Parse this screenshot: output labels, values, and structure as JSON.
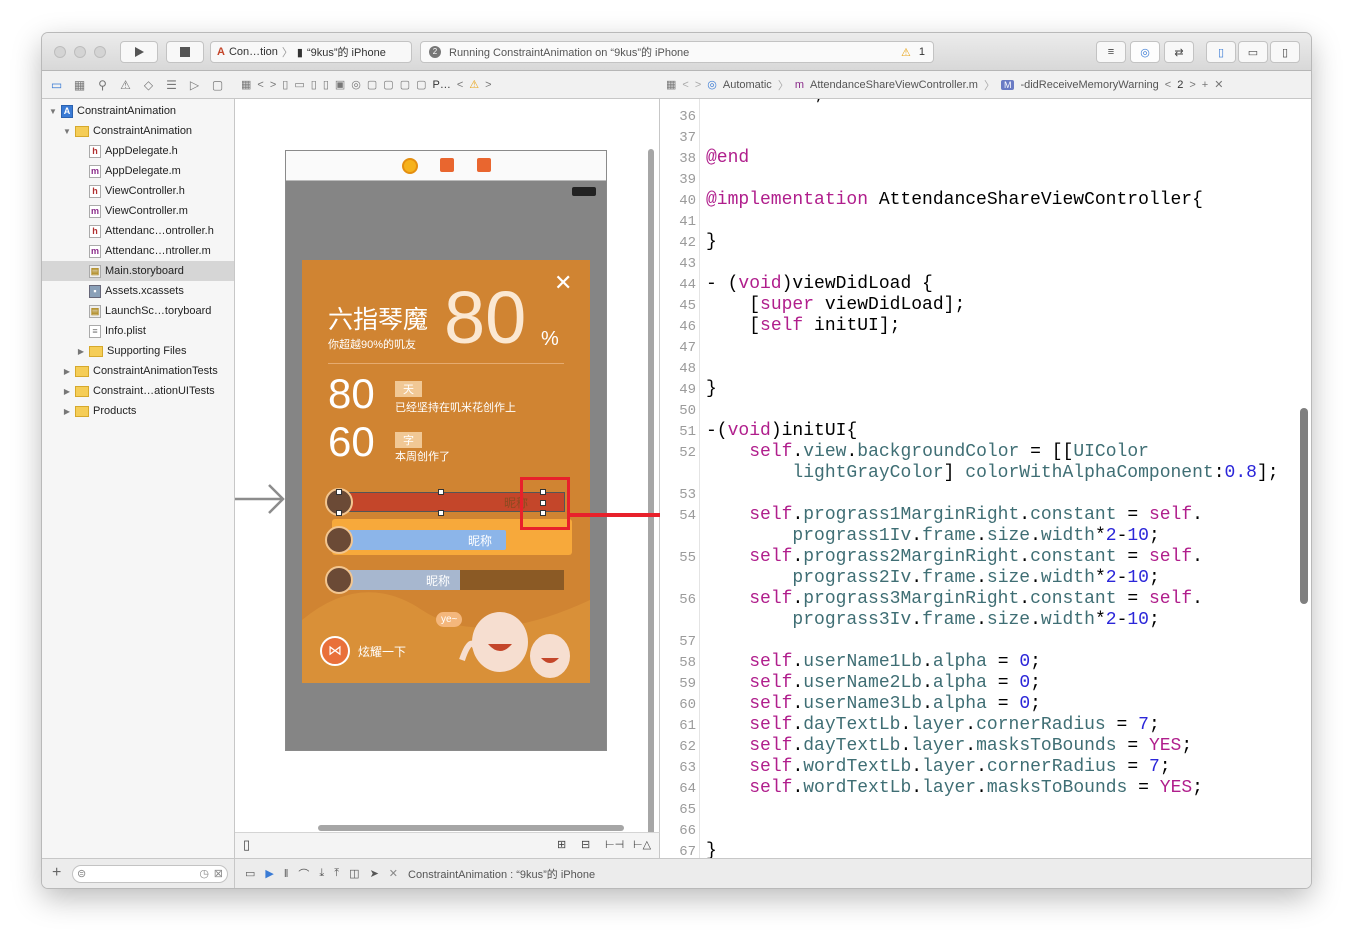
{
  "toolbar": {
    "scheme_target": "Con…tion",
    "scheme_device": "“9kus”的 iPhone",
    "activity_text": "Running ConstraintAnimation on “9kus”的 iPhone",
    "warning_count": "1"
  },
  "navigator": {
    "items": [
      {
        "label": "ConstraintAnimation",
        "icon": "project-icon"
      },
      {
        "label": "ConstraintAnimation",
        "icon": "folder-icon"
      },
      {
        "label": "AppDelegate.h",
        "icon": "header-file-icon"
      },
      {
        "label": "AppDelegate.m",
        "icon": "impl-file-icon"
      },
      {
        "label": "ViewController.h",
        "icon": "header-file-icon"
      },
      {
        "label": "ViewController.m",
        "icon": "impl-file-icon"
      },
      {
        "label": "Attendanc…ontroller.h",
        "icon": "header-file-icon"
      },
      {
        "label": "Attendanc…ntroller.m",
        "icon": "impl-file-icon"
      },
      {
        "label": "Main.storyboard",
        "icon": "storyboard-icon"
      },
      {
        "label": "Assets.xcassets",
        "icon": "assets-icon"
      },
      {
        "label": "LaunchSc…toryboard",
        "icon": "storyboard-icon"
      },
      {
        "label": "Info.plist",
        "icon": "plist-icon"
      },
      {
        "label": "Supporting Files",
        "icon": "folder-icon"
      },
      {
        "label": "ConstraintAnimationTests",
        "icon": "folder-icon"
      },
      {
        "label": "Constraint…ationUITests",
        "icon": "folder-icon"
      },
      {
        "label": "Products",
        "icon": "folder-icon"
      }
    ]
  },
  "canvas": {
    "jump_item": "P…"
  },
  "phone_card": {
    "title": "六指琴魔",
    "percent": "80",
    "percent_sign": "%",
    "subtitle": "你超越90%的叽友",
    "days_value": "80",
    "days_tag": "天",
    "days_desc": "已经坚持在叽米花创作上",
    "words_value": "60",
    "words_tag": "字",
    "words_desc": "本周创作了",
    "nickname": "昵称",
    "share_label": "炫耀一下",
    "bubble": "ye~"
  },
  "editor_jump": {
    "mode": "Automatic",
    "file": "AttendanceShareViewController.m",
    "method_badge": "M",
    "method": "-didReceiveMemoryWarning",
    "counter": "2"
  },
  "code": {
    "line_numbers": [
      "36",
      "37",
      "38",
      "39",
      "40",
      "41",
      "42",
      "43",
      "44",
      "45",
      "46",
      "47",
      "48",
      "49",
      "50",
      "51",
      "52",
      "",
      "53",
      "54",
      "",
      "55",
      "",
      "56",
      "",
      "57",
      "58",
      "59",
      "60",
      "61",
      "62",
      "63",
      "64",
      "65",
      "66",
      "67"
    ]
  },
  "debug": {
    "target": "ConstraintAnimation : “9kus”的 iPhone"
  },
  "colors": {
    "accent": "#3a7bd5",
    "card_orange": "#d08432",
    "arrow_red": "#e8212b",
    "keyword": "#b01e8c",
    "property": "#3f6e74",
    "number": "#2b26d9"
  }
}
